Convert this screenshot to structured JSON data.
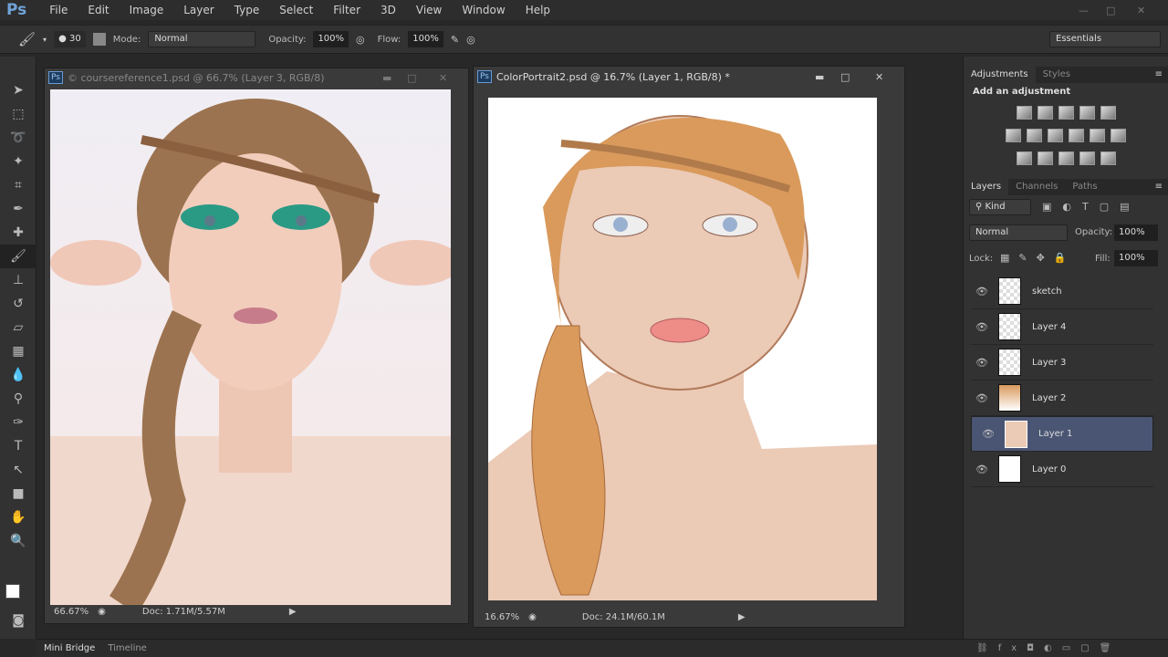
{
  "app": {
    "logo": "Ps"
  },
  "menu": [
    "File",
    "Edit",
    "Image",
    "Layer",
    "Type",
    "Select",
    "Filter",
    "3D",
    "View",
    "Window",
    "Help"
  ],
  "options": {
    "brush_size": "30",
    "mode_label": "Mode:",
    "mode_value": "Normal",
    "opacity_label": "Opacity:",
    "opacity_value": "100%",
    "flow_label": "Flow:",
    "flow_value": "100%",
    "workspace": "Essentials"
  },
  "doc1": {
    "title": "© coursereference1.psd @ 66.7% (Layer 3, RGB/8)",
    "zoom": "66.67%",
    "doc": "Doc: 1.71M/5.57M"
  },
  "doc2": {
    "title": "ColorPortrait2.psd @ 16.7% (Layer 1, RGB/8) *",
    "zoom": "16.67%",
    "doc": "Doc: 24.1M/60.1M"
  },
  "adjustments": {
    "tabs": [
      "Adjustments",
      "Styles"
    ],
    "heading": "Add an adjustment"
  },
  "layers_panel": {
    "tabs": [
      "Layers",
      "Channels",
      "Paths"
    ],
    "filter": "Kind",
    "blend": "Normal",
    "opacity_label": "Opacity:",
    "opacity": "100%",
    "lock_label": "Lock:",
    "fill_label": "Fill:",
    "fill": "100%",
    "layers": [
      {
        "name": "sketch",
        "selected": false
      },
      {
        "name": "Layer 4",
        "selected": false
      },
      {
        "name": "Layer 3",
        "selected": false
      },
      {
        "name": "Layer 2",
        "selected": false
      },
      {
        "name": "Layer 1",
        "selected": true
      },
      {
        "name": "Layer 0",
        "selected": false
      }
    ]
  },
  "bottom": {
    "tabs": [
      "Mini Bridge",
      "Timeline"
    ]
  }
}
